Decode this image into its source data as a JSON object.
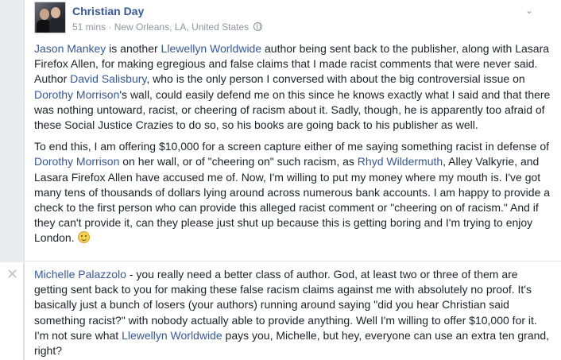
{
  "post": {
    "author": "Christian Day",
    "time": "51 mins",
    "separator": "·",
    "location": "New Orleans, LA, United States",
    "globe_icon": "globe-icon",
    "paragraph1": {
      "link1": "Jason Mankey",
      "t1": " is another ",
      "link2": "Llewellyn Worldwide",
      "t2": " author being sent back to the publisher, along with Lasara Firefox Allen, for making egregious and false claims that I made racist comments that were never said. Author ",
      "link3": "David Salisbury",
      "t3": ", who is the only person I conversed with about the big controversial issue on ",
      "link4": "Dorothy Morrison",
      "t4": "'s wall, could easily defend me on this since he knows exactly what I said and that there was nothing untoward, racist, or cheering of racism about it. Sadly, though, he is apparently too afraid of these Social Justice Crazies to do so, so his books are going back to his publisher as well."
    },
    "paragraph2": {
      "t1": "To end this, I am offering $10,000 for a screen capture either of me saying something racist in defense of ",
      "link1": "Dorothy Morrison",
      "t2": " on her wall, or of \"cheering on\" such racism, as ",
      "link2": "Rhyd Wildermuth",
      "t3": ", Alley Valkyrie, and Lasara Firefox Allen have accused me of. Now, I'm willing to put my money where my mouth is. I've got many tens of thousands of dollars lying around across numerous bank accounts. I am happy to provide a check to the first person who can provide this alleged racist comment or \"cheering on of racism.\" And if they can't provide it, can they please just shut up because this is getting boring and I'm trying to enjoy London. ",
      "emoji": "smile-emoji"
    }
  },
  "comment": {
    "link1": "Michelle Palazzolo",
    "t1": " - you really need a better class of author. God, at least two or three of them are getting sent back to you for making these false racism claims against me with absolutely no proof. It's basically just a bunch of losers (your authors) running around saying \"did you hear Christian said something racist?\" with nobody actually able to provide anything. Well I'm willing to offer $10,000 for it. I'm not sure what ",
    "link2": "Llewellyn Worldwide",
    "t2": " pays you, Michelle, but hey, everyone can use an extra ten grand, right?",
    "close_symbol": "✕"
  },
  "colors": {
    "link": "#365899",
    "text": "#1d2129",
    "meta": "#90949c",
    "background": "#e9ebee"
  }
}
